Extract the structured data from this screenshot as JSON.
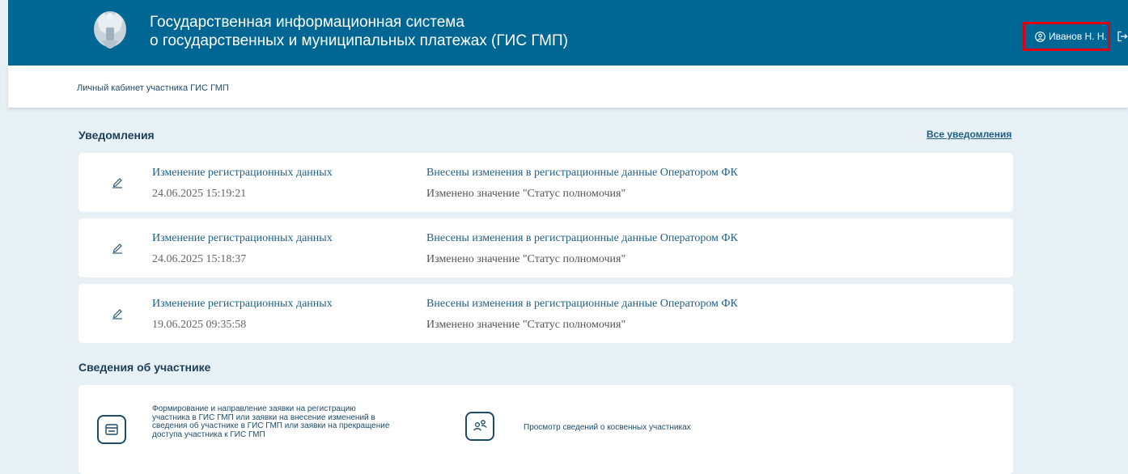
{
  "header": {
    "title_line1": "Государственная информационная система",
    "title_line2": "о государственных и муниципальных платежах (ГИС ГМП)",
    "user_name": "Иванов Н. Н."
  },
  "breadcrumb": "Личный кабинет участника ГИС ГМП",
  "notifications": {
    "title": "Уведомления",
    "all_link": "Все уведомления",
    "items": [
      {
        "title": "Изменение регистрационных данных",
        "date": "24.06.2025 15:19:21",
        "message": "Внесены изменения в регистрационные данные Оператором ФК",
        "detail": "Изменено значение \"Статус полномочия\""
      },
      {
        "title": "Изменение регистрационных данных",
        "date": "24.06.2025 15:18:37",
        "message": "Внесены изменения в регистрационные данные Оператором ФК",
        "detail": "Изменено значение \"Статус полномочия\""
      },
      {
        "title": "Изменение регистрационных данных",
        "date": "19.06.2025 09:35:58",
        "message": "Внесены изменения в регистрационные данные Оператором ФК",
        "detail": "Изменено значение \"Статус полномочия\""
      }
    ]
  },
  "participant": {
    "title": "Сведения об участнике",
    "services": [
      {
        "label": "Формирование и направление заявки на регистрацию участника в ГИС ГМП или заявки на внесение изменений в сведения об участнике в ГИС ГМП или заявки на прекращение доступа участника к ГИС ГМП",
        "icon": "tray-icon"
      },
      {
        "label": "Просмотр сведений о косвенных участниках",
        "icon": "users-icon"
      }
    ]
  },
  "colors": {
    "header_bg": "#006694",
    "page_bg": "#e6f0f5",
    "link": "#1f5f86",
    "highlight": "#e00010"
  }
}
